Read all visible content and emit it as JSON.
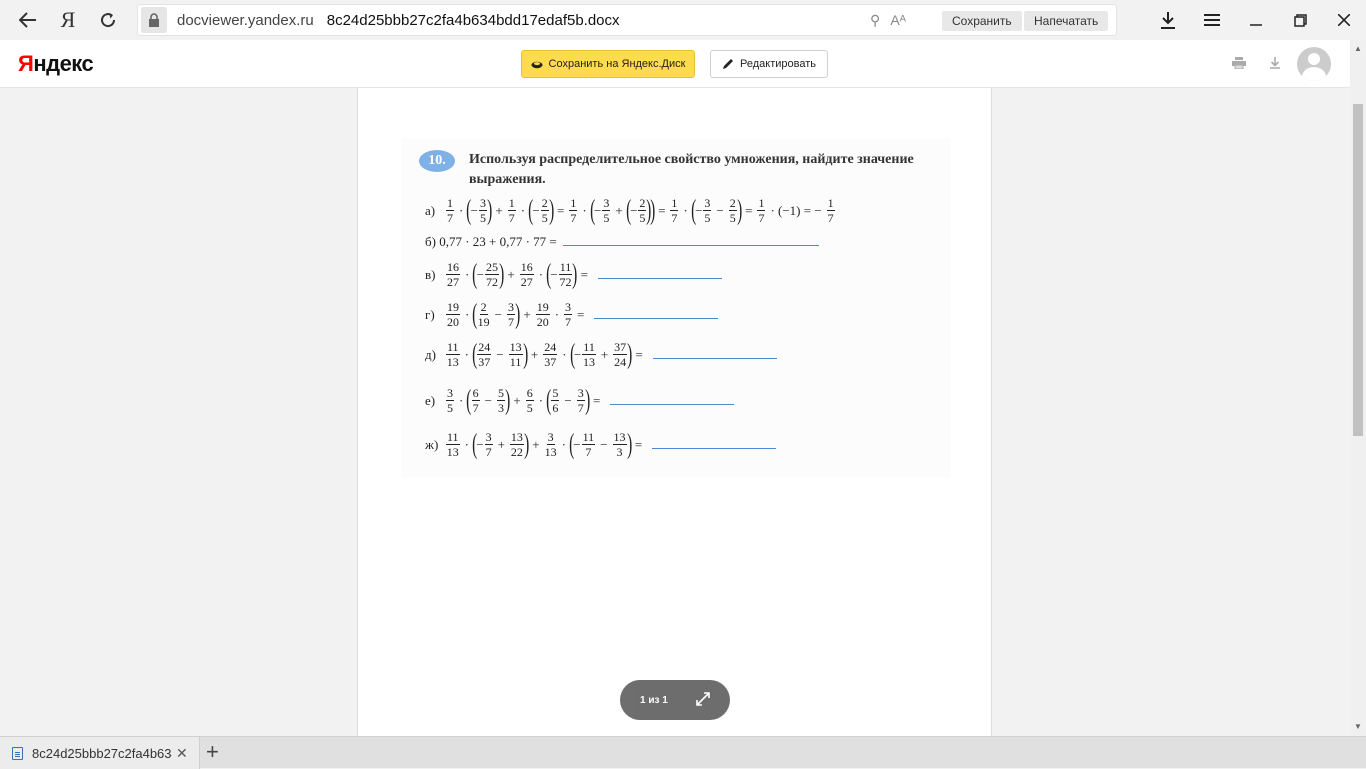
{
  "browser": {
    "ya_label": "Я",
    "domain": "docviewer.yandex.ru",
    "path": "8c24d25bbb27c2fa4b634bdd17edaf5b.docx",
    "save_pill": "Сохранить",
    "print_pill": "Напечатать"
  },
  "header": {
    "logo_first": "Я",
    "logo_rest": "ндекс",
    "save_to_disk": "Сохранить на Яндекс.Диск",
    "edit": "Редактировать"
  },
  "document": {
    "task_number": "10.",
    "task_text": "Используя распределительное свойство умножения, найдите значение выражения.",
    "row_b": "б) 0,77 · 23 + 0,77 · 77 ="
  },
  "pager": {
    "label": "1 из 1"
  },
  "download": {
    "filename": "8c24d25bbb27c2fa4b634bdd17edaf5b.docx"
  },
  "colors": {
    "accent_yellow": "#ffdb4d",
    "answer_line": "#4a8bd1",
    "task_badge": "#7fb0e6"
  }
}
